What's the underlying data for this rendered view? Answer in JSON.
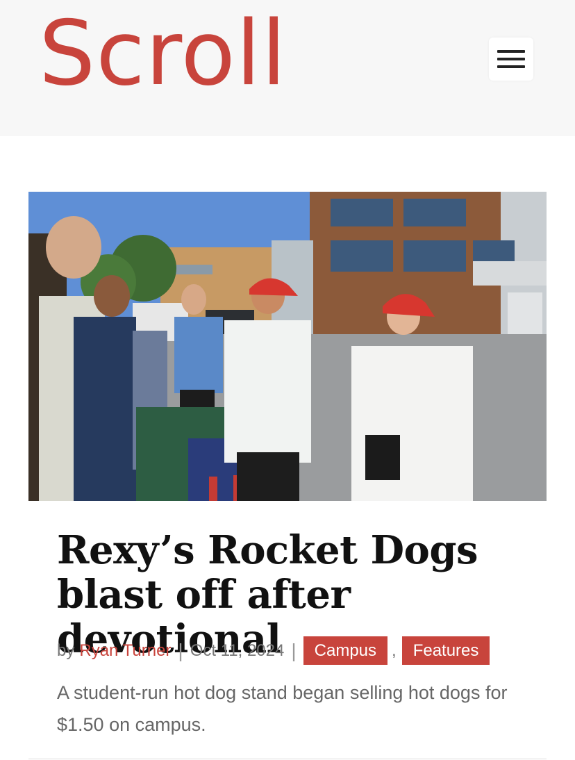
{
  "header": {
    "logo_text": "Scroll",
    "menu_icon": "hamburger-menu-icon",
    "brand_color": "#c8443c"
  },
  "article": {
    "image_alt": "Students in red caps serving hot dogs at an outdoor stand on campus",
    "title": "Rexy’s Rocket Dogs blast off after devotional",
    "byline_prefix": "by",
    "author": "Ryan Turner",
    "separator": "|",
    "date": "Oct 11, 2024",
    "categories": [
      "Campus",
      "Features"
    ],
    "category_separator": ",",
    "excerpt": "A student-run hot dog stand began selling hot dogs for $1.50 on campus."
  }
}
